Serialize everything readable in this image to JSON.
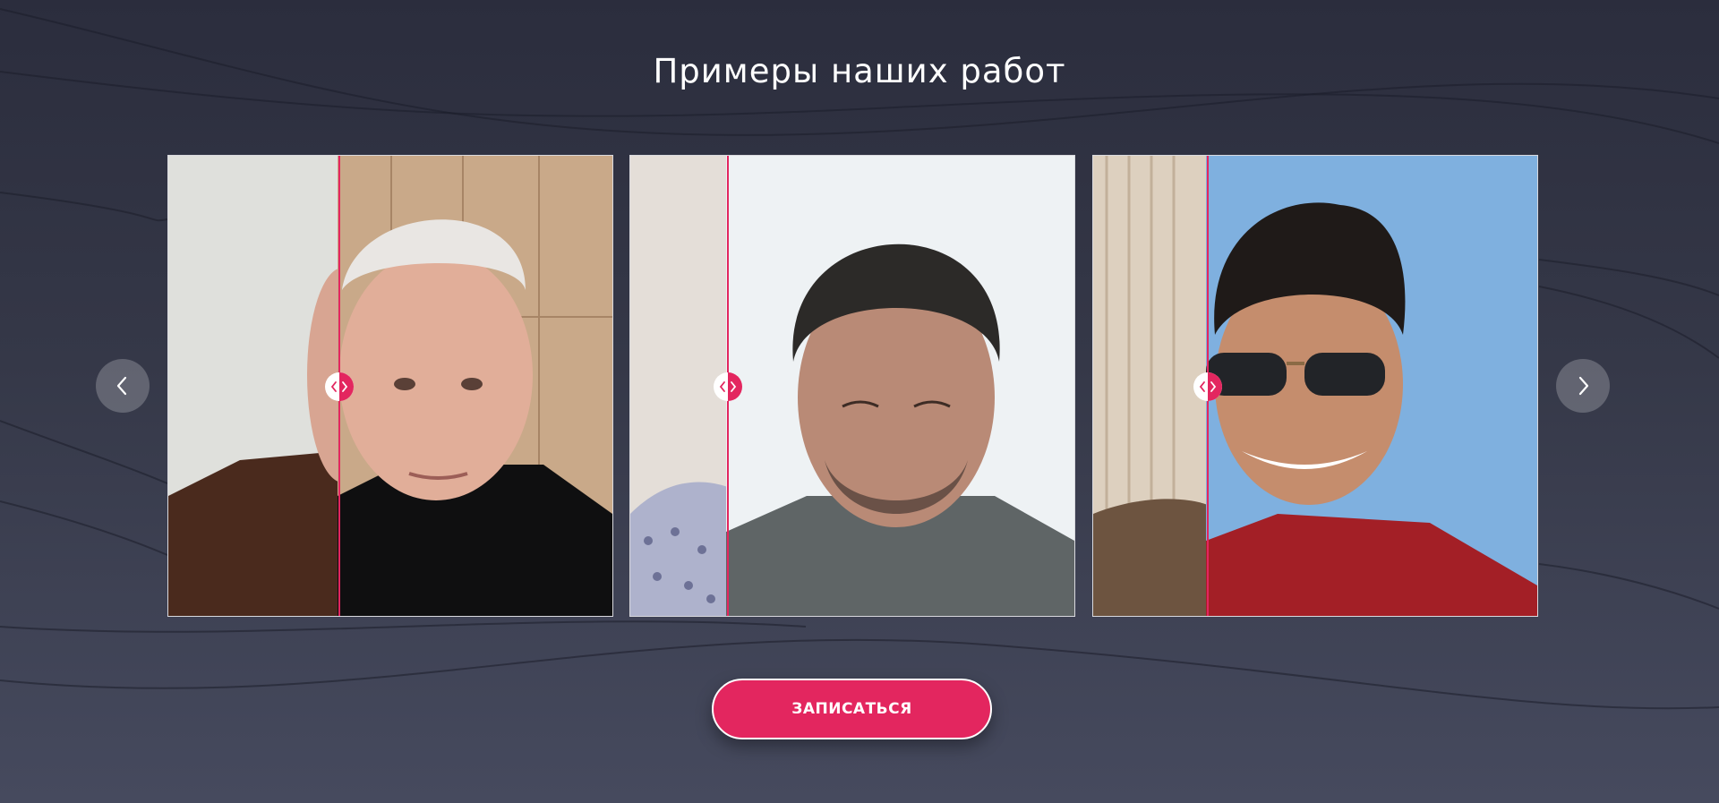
{
  "section": {
    "title": "Примеры наших работ"
  },
  "navigation": {
    "prev_icon": "chevron-left-icon",
    "next_icon": "chevron-right-icon"
  },
  "slides": [
    {
      "handle_icon": "compare-arrows-icon"
    },
    {
      "handle_icon": "compare-arrows-icon"
    },
    {
      "handle_icon": "compare-arrows-icon"
    }
  ],
  "cta": {
    "label": "ЗАПИСАТЬСЯ"
  },
  "colors": {
    "accent": "#e3265f",
    "background_top": "#2b2d3d",
    "background_bottom": "#464a5e",
    "text": "#ffffff"
  }
}
